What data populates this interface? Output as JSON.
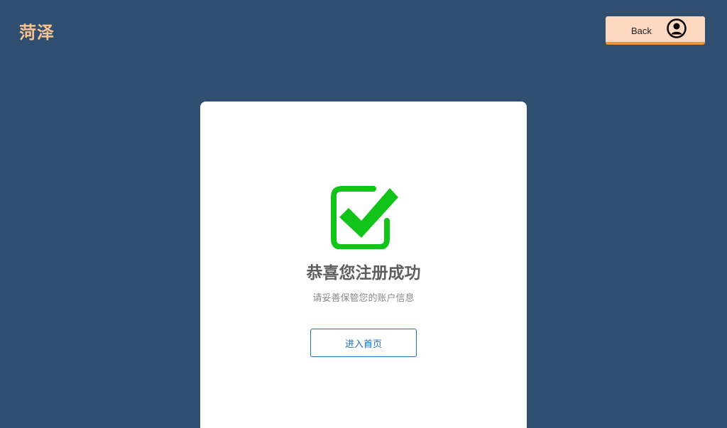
{
  "header": {
    "logo_text": "菏泽",
    "back_label": "Back",
    "back_icon": "user-avatar-icon"
  },
  "card": {
    "icon": "checkbox-check-icon",
    "title": "恭喜您注册成功",
    "subtitle": "请妥善保管您的账户信息",
    "enter_button_label": "进入首页"
  },
  "colors": {
    "background": "#2f4e70",
    "logo": "#f6c28e",
    "back_button_bg": "#fcd8c0",
    "back_button_accent": "#e9943e",
    "check_green": "#12c41a",
    "link_blue": "#1f6fc1"
  }
}
